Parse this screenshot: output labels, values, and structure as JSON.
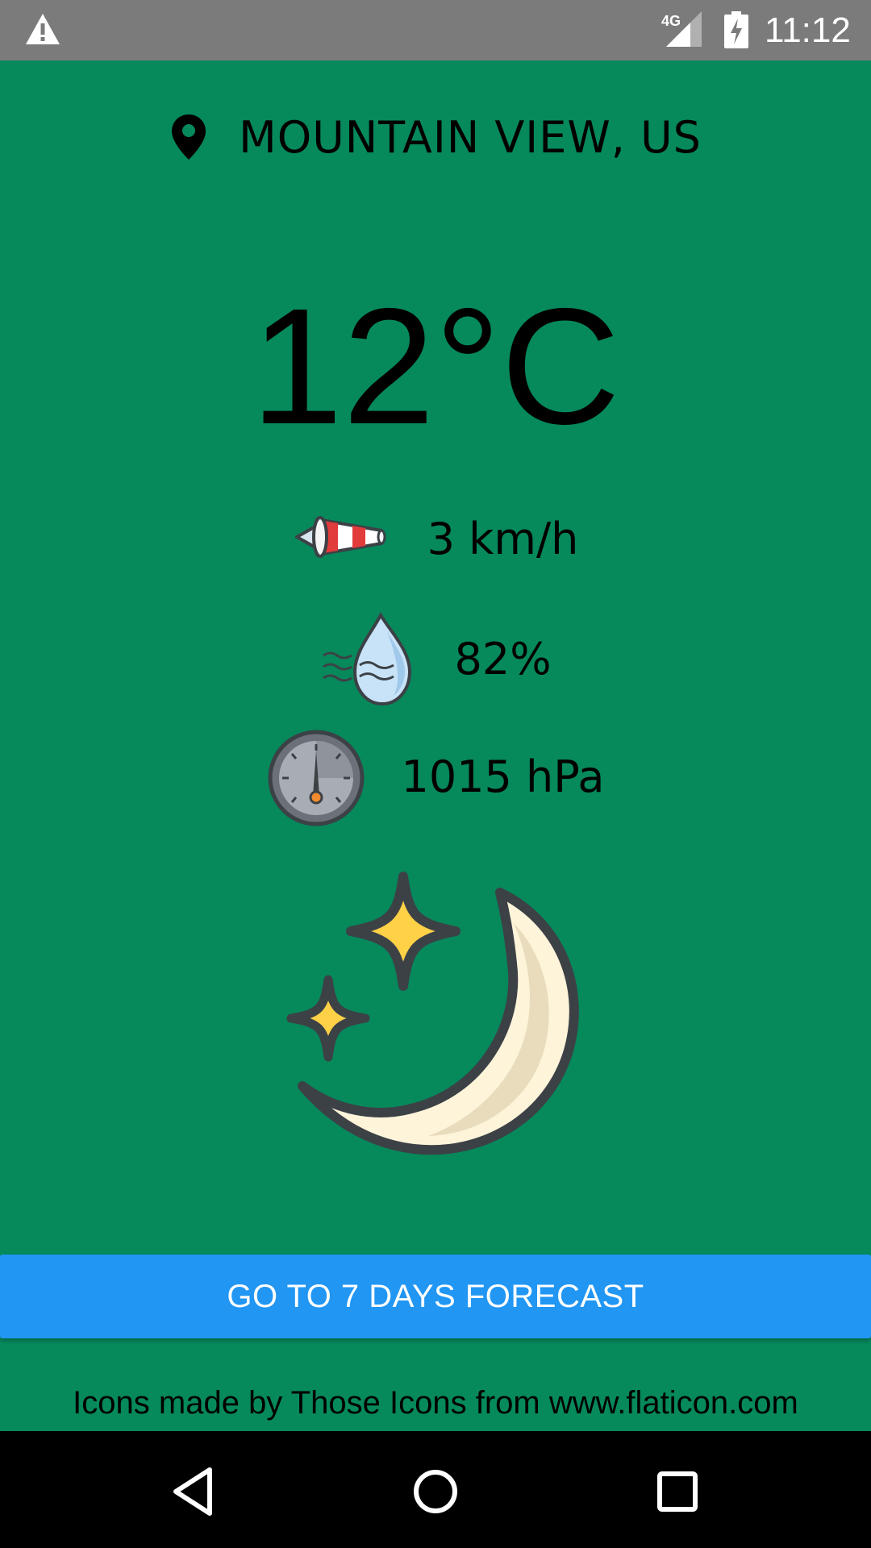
{
  "status_bar": {
    "time": "11:12",
    "network": "4G",
    "icons": [
      "warning-icon",
      "signal-icon",
      "battery-charging-icon"
    ]
  },
  "location": {
    "icon": "location-pin-icon",
    "city": "MOUNTAIN VIEW, US"
  },
  "current": {
    "temperature": "12°C",
    "wind": {
      "icon": "windsock-icon",
      "value": "3 km/h"
    },
    "humidity": {
      "icon": "humidity-drop-icon",
      "value": "82%"
    },
    "pressure": {
      "icon": "barometer-icon",
      "value": "1015 hPa"
    },
    "condition_icon": "moon-stars-icon"
  },
  "forecast_button": {
    "label": "GO TO 7 DAYS FORECAST",
    "color": "#2196f3"
  },
  "credit": "Icons made by Those Icons from www.flaticon.com",
  "nav_bar": {
    "icons": [
      "back-icon",
      "home-icon",
      "recents-icon"
    ]
  },
  "colors": {
    "background": "#06895b",
    "status_bar": "#7b7b7b",
    "nav_bar": "#000000"
  }
}
